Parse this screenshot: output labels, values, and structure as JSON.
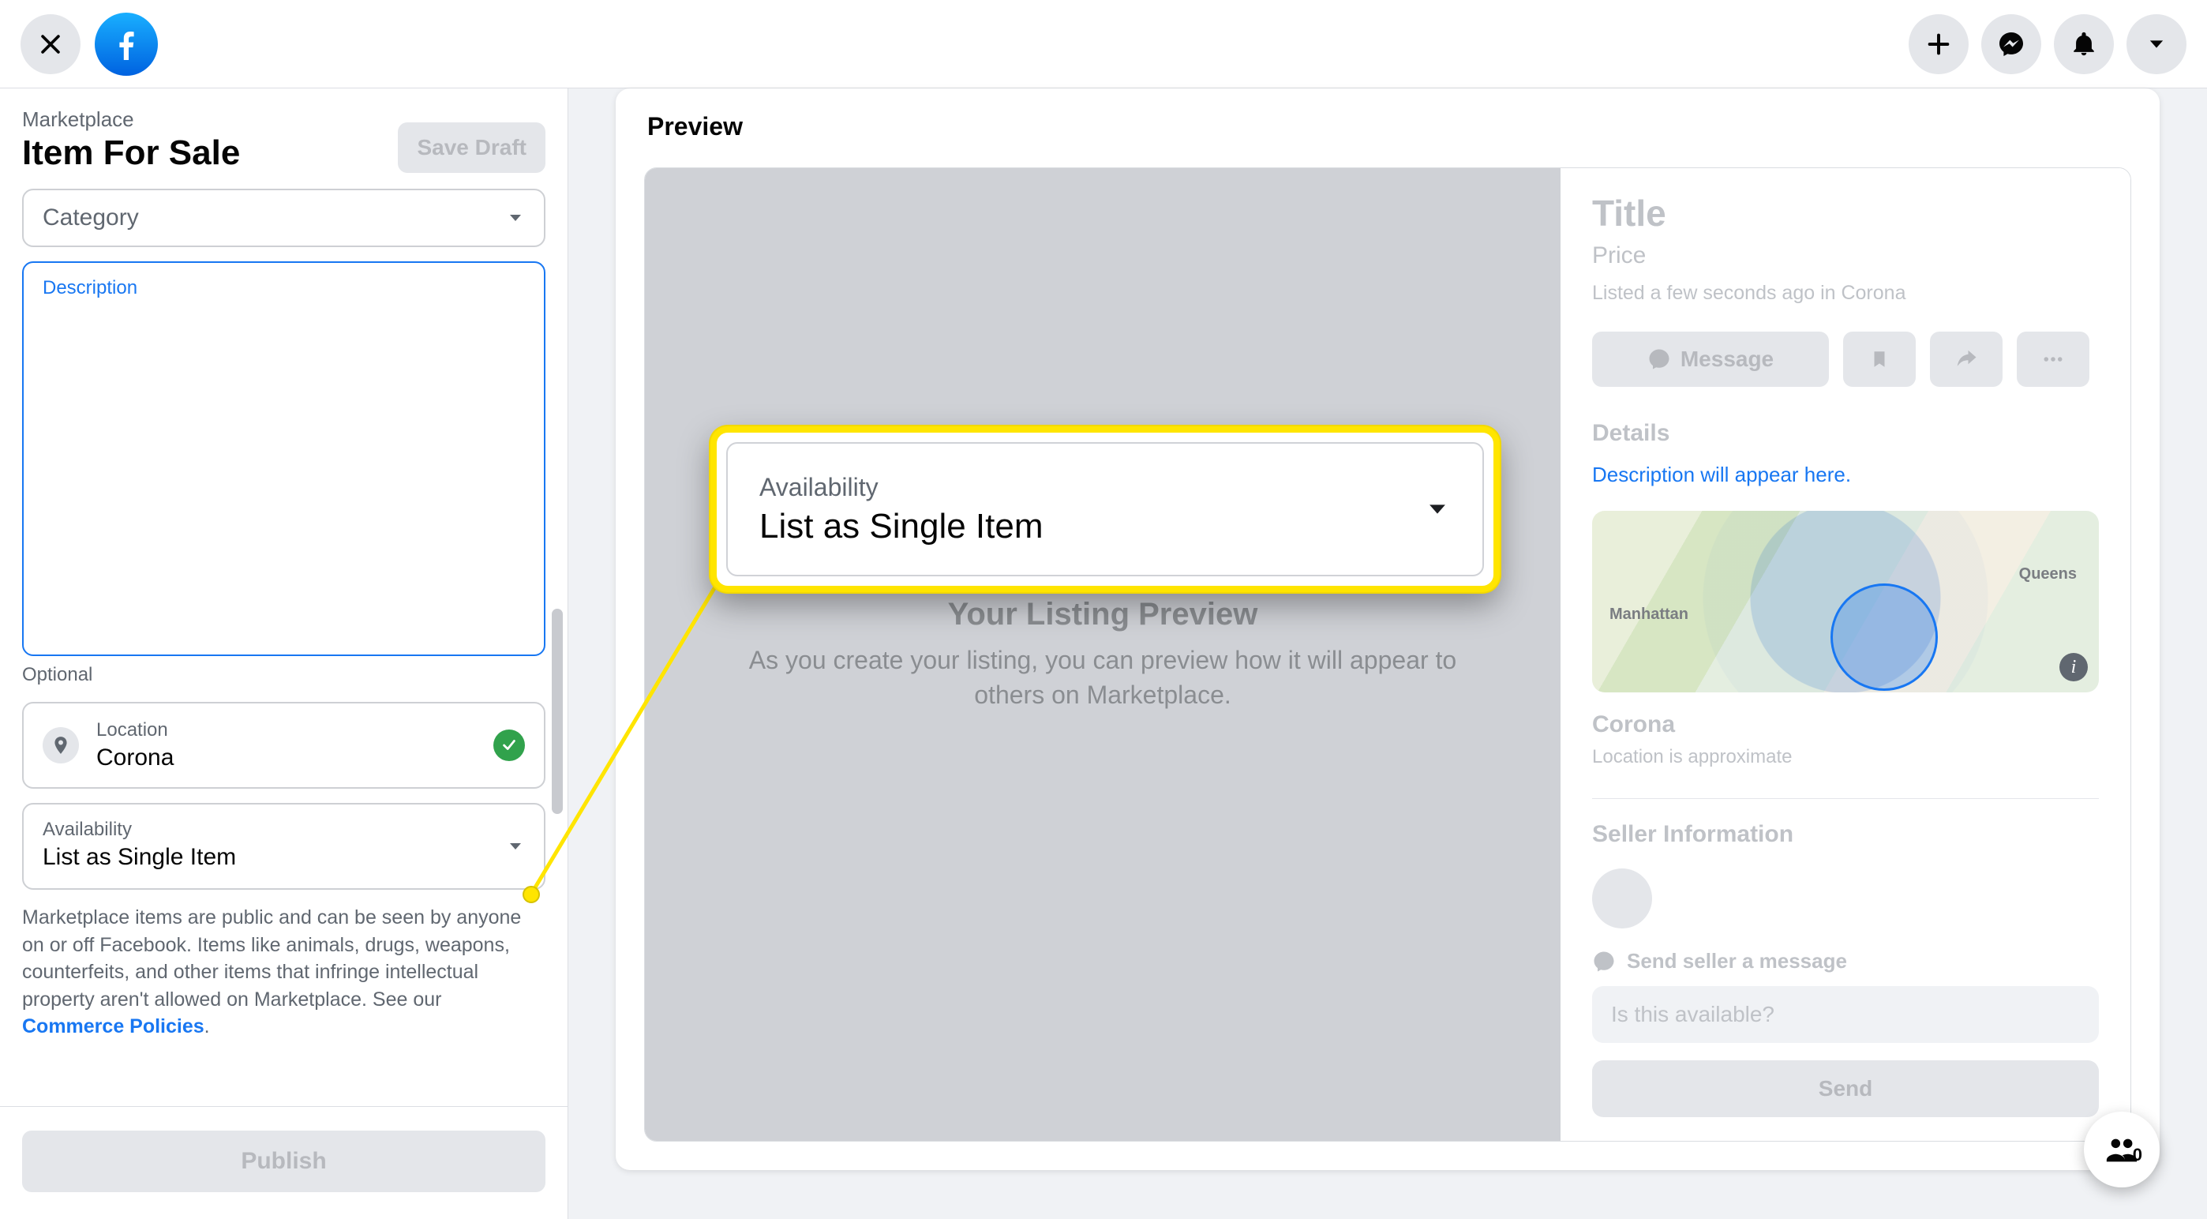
{
  "topbar": {
    "icons": {
      "close": "close",
      "logo": "f",
      "create": "plus",
      "messenger": "messenger",
      "notifications": "bell",
      "account": "caret"
    }
  },
  "sidebar": {
    "crumb": "Marketplace",
    "title": "Item For Sale",
    "save_draft_label": "Save Draft",
    "category": {
      "label": "Category"
    },
    "description": {
      "label": "Description"
    },
    "optional_hint": "Optional",
    "location": {
      "label": "Location",
      "value": "Corona"
    },
    "availability": {
      "label": "Availability",
      "value": "List as Single Item"
    },
    "disclaimer": {
      "text": "Marketplace items are public and can be seen by anyone on or off Facebook. Items like animals, drugs, weapons, counterfeits, and other items that infringe intellectual property aren't allowed on Marketplace. See our ",
      "link": "Commerce Policies",
      "tail": "."
    },
    "publish_label": "Publish"
  },
  "callout": {
    "label": "Availability",
    "value": "List as Single Item"
  },
  "preview": {
    "heading": "Preview",
    "placeholder_title": "Your Listing Preview",
    "placeholder_body": "As you create your listing, you can preview how it will appear to others on Marketplace.",
    "side": {
      "title": "Title",
      "price": "Price",
      "meta": "Listed a few seconds ago in Corona",
      "message_btn": "Message",
      "details_heading": "Details",
      "description_hint": "Description will appear here.",
      "map": {
        "left_label": "Manhattan",
        "right_label": "Queens"
      },
      "location_name": "Corona",
      "location_sub": "Location is approximate",
      "seller_heading": "Seller Information",
      "message_label": "Send seller a message",
      "message_placeholder": "Is this available?",
      "send_label": "Send"
    }
  },
  "floating_group": {
    "count": "0"
  }
}
